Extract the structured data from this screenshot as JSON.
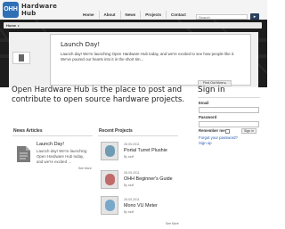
{
  "header": {
    "logo_badge": "OHH",
    "logo_line1": "Hardware",
    "logo_line2": "Hub",
    "nav": [
      "Home",
      "About",
      "News",
      "Projects",
      "Contact"
    ],
    "search_placeholder": "Search",
    "search_button": "▸"
  },
  "breadcrumb": {
    "home": "Home",
    "separator": "▸"
  },
  "slideshow": {
    "title": "Launch Day!",
    "body": "Launch day! We're launching Open Hardware Hub today, and we're excited to see how people like it. We've poured our hearts into it in the short tim...",
    "button": "Find Out More ▸"
  },
  "main": {
    "headline": "Open Hardware Hub is the place to post and contribute to open source hardware projects."
  },
  "news": {
    "heading": "News Articles",
    "title": "Launch Day!",
    "body": "Launch day! We're launching Open Hardware Hub today, and we're excited ...",
    "see_more": "See More"
  },
  "projects": {
    "heading": "Recent Projects",
    "items": [
      {
        "date": "28.05.2011",
        "name": "Portal Turret Plushie",
        "by": "By stuff"
      },
      {
        "date": "28.05.2011",
        "name": "OHH Beginner's Guide",
        "by": "By stuff"
      },
      {
        "date": "28.05.2011",
        "name": "Mono VU Meter",
        "by": "By stuff"
      }
    ],
    "see_more": "See More"
  },
  "signin": {
    "title": "Sign in",
    "email_label": "Email",
    "password_label": "Password",
    "remember_label": "Remember me",
    "button": "Sign in",
    "forgot": "Forgot your password?",
    "signup": "Sign up"
  },
  "colors": {
    "brand_blue": "#2f6fb6",
    "dark_band": "#1d1d1d",
    "link_blue": "#2a5db0"
  }
}
